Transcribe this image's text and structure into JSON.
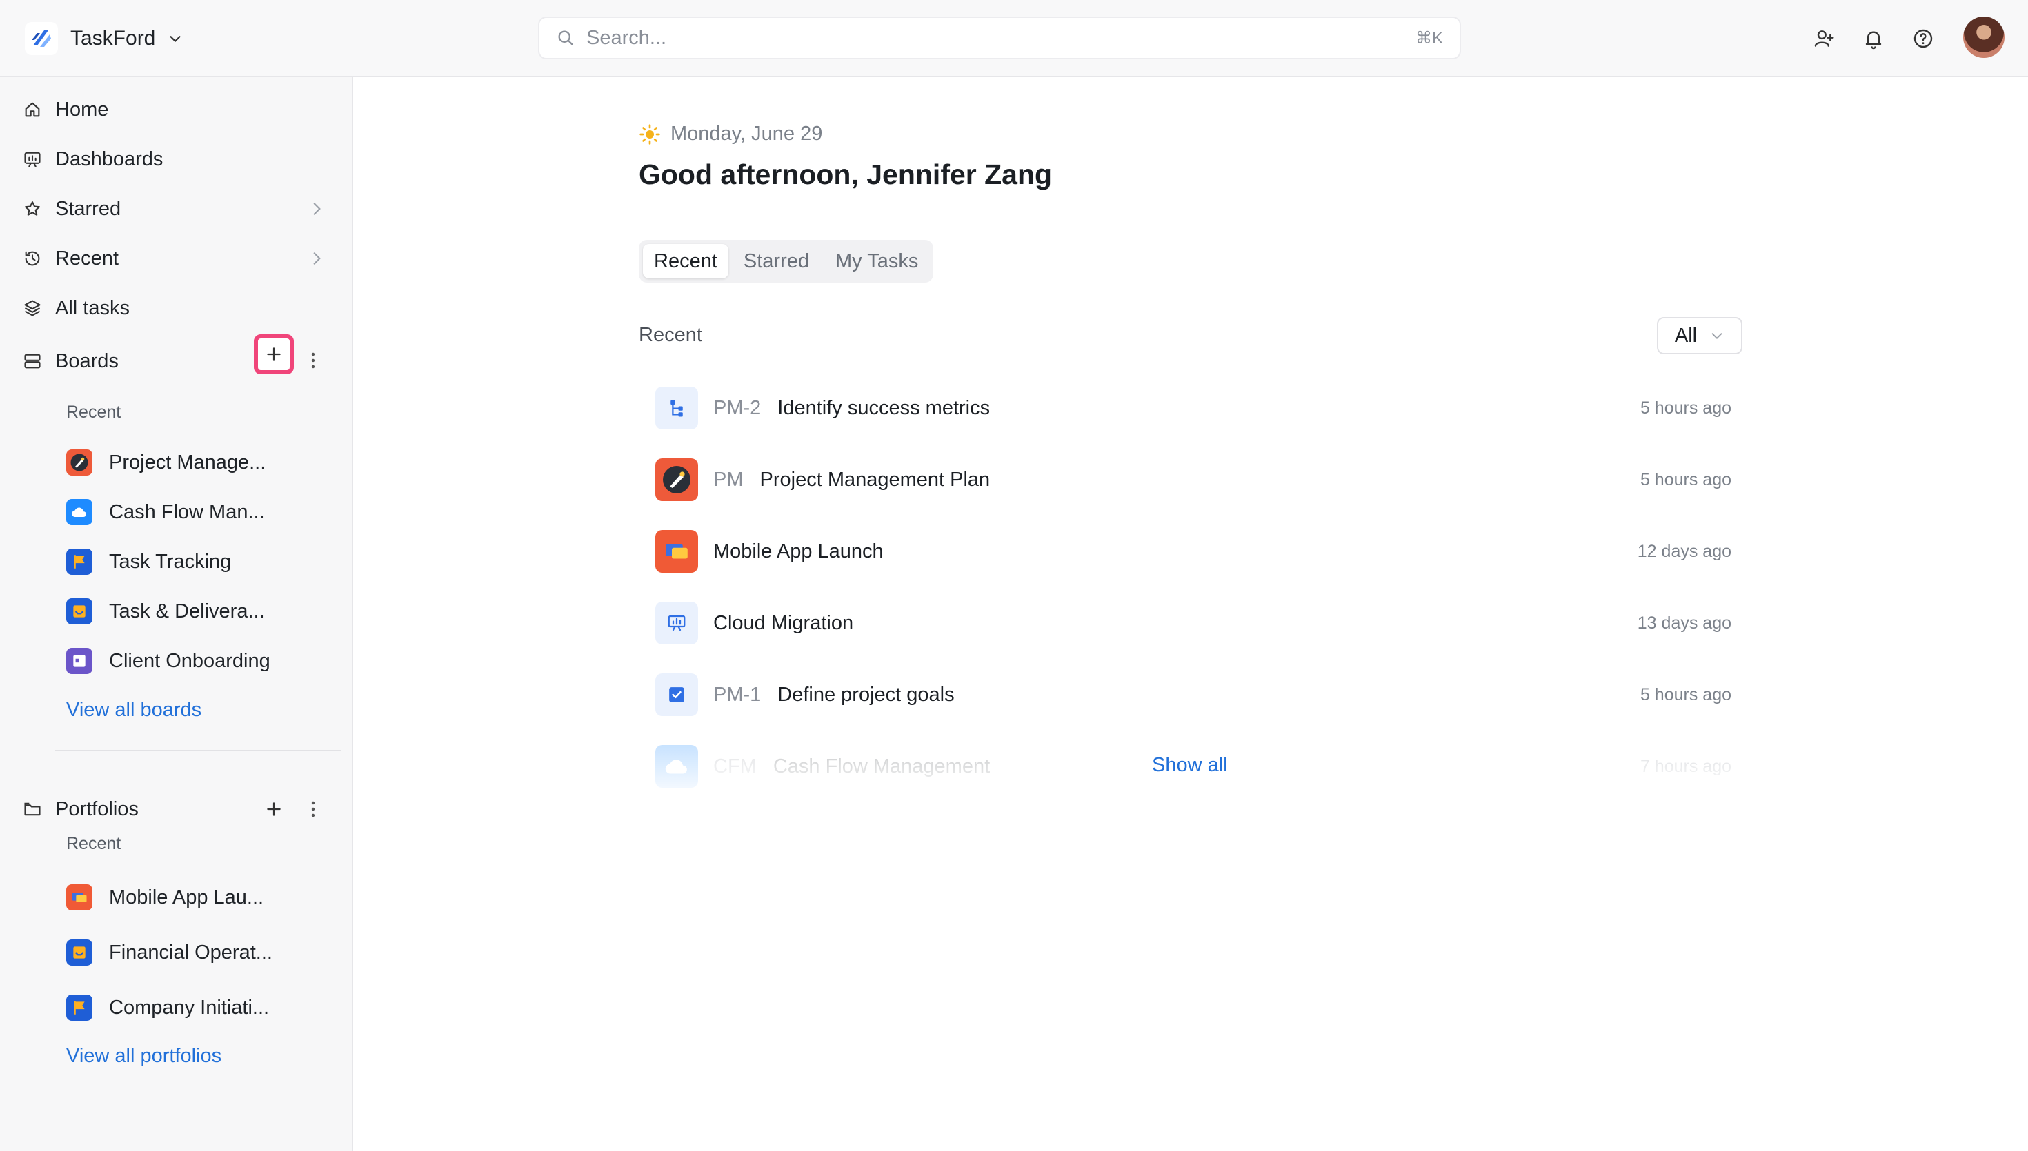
{
  "app": {
    "name": "TaskFord"
  },
  "search": {
    "placeholder": "Search...",
    "shortcut": "⌘K"
  },
  "sidebar": {
    "nav": [
      {
        "label": "Home"
      },
      {
        "label": "Dashboards"
      },
      {
        "label": "Starred"
      },
      {
        "label": "Recent"
      },
      {
        "label": "All tasks"
      }
    ],
    "boards": {
      "title": "Boards",
      "recent_label": "Recent",
      "items": [
        {
          "label": "Project Manage..."
        },
        {
          "label": "Cash Flow Man..."
        },
        {
          "label": "Task Tracking"
        },
        {
          "label": "Task & Delivera..."
        },
        {
          "label": "Client Onboarding"
        }
      ],
      "view_all": "View all boards"
    },
    "portfolios": {
      "title": "Portfolios",
      "recent_label": "Recent",
      "items": [
        {
          "label": "Mobile App Lau..."
        },
        {
          "label": "Financial Operat..."
        },
        {
          "label": "Company Initiati..."
        }
      ],
      "view_all": "View all portfolios"
    }
  },
  "main": {
    "date": "Monday, June 29",
    "greeting": "Good afternoon, Jennifer Zang",
    "tabs": [
      {
        "label": "Recent"
      },
      {
        "label": "Starred"
      },
      {
        "label": "My Tasks"
      }
    ],
    "section_title": "Recent",
    "filter": "All",
    "items": [
      {
        "key": "PM-2",
        "title": "Identify success metrics",
        "time": "5 hours ago"
      },
      {
        "key": "PM",
        "title": "Project Management Plan",
        "time": "5 hours ago"
      },
      {
        "key": "",
        "title": "Mobile App Launch",
        "time": "12 days ago"
      },
      {
        "key": "",
        "title": "Cloud Migration",
        "time": "13 days ago"
      },
      {
        "key": "PM-1",
        "title": "Define project goals",
        "time": "5 hours ago"
      },
      {
        "key": "CFM",
        "title": "Cash Flow Management",
        "time": "7 hours ago"
      }
    ],
    "show_all": "Show all"
  },
  "colors": {
    "accent": "#2170d9",
    "highlight": "#f0457a"
  }
}
